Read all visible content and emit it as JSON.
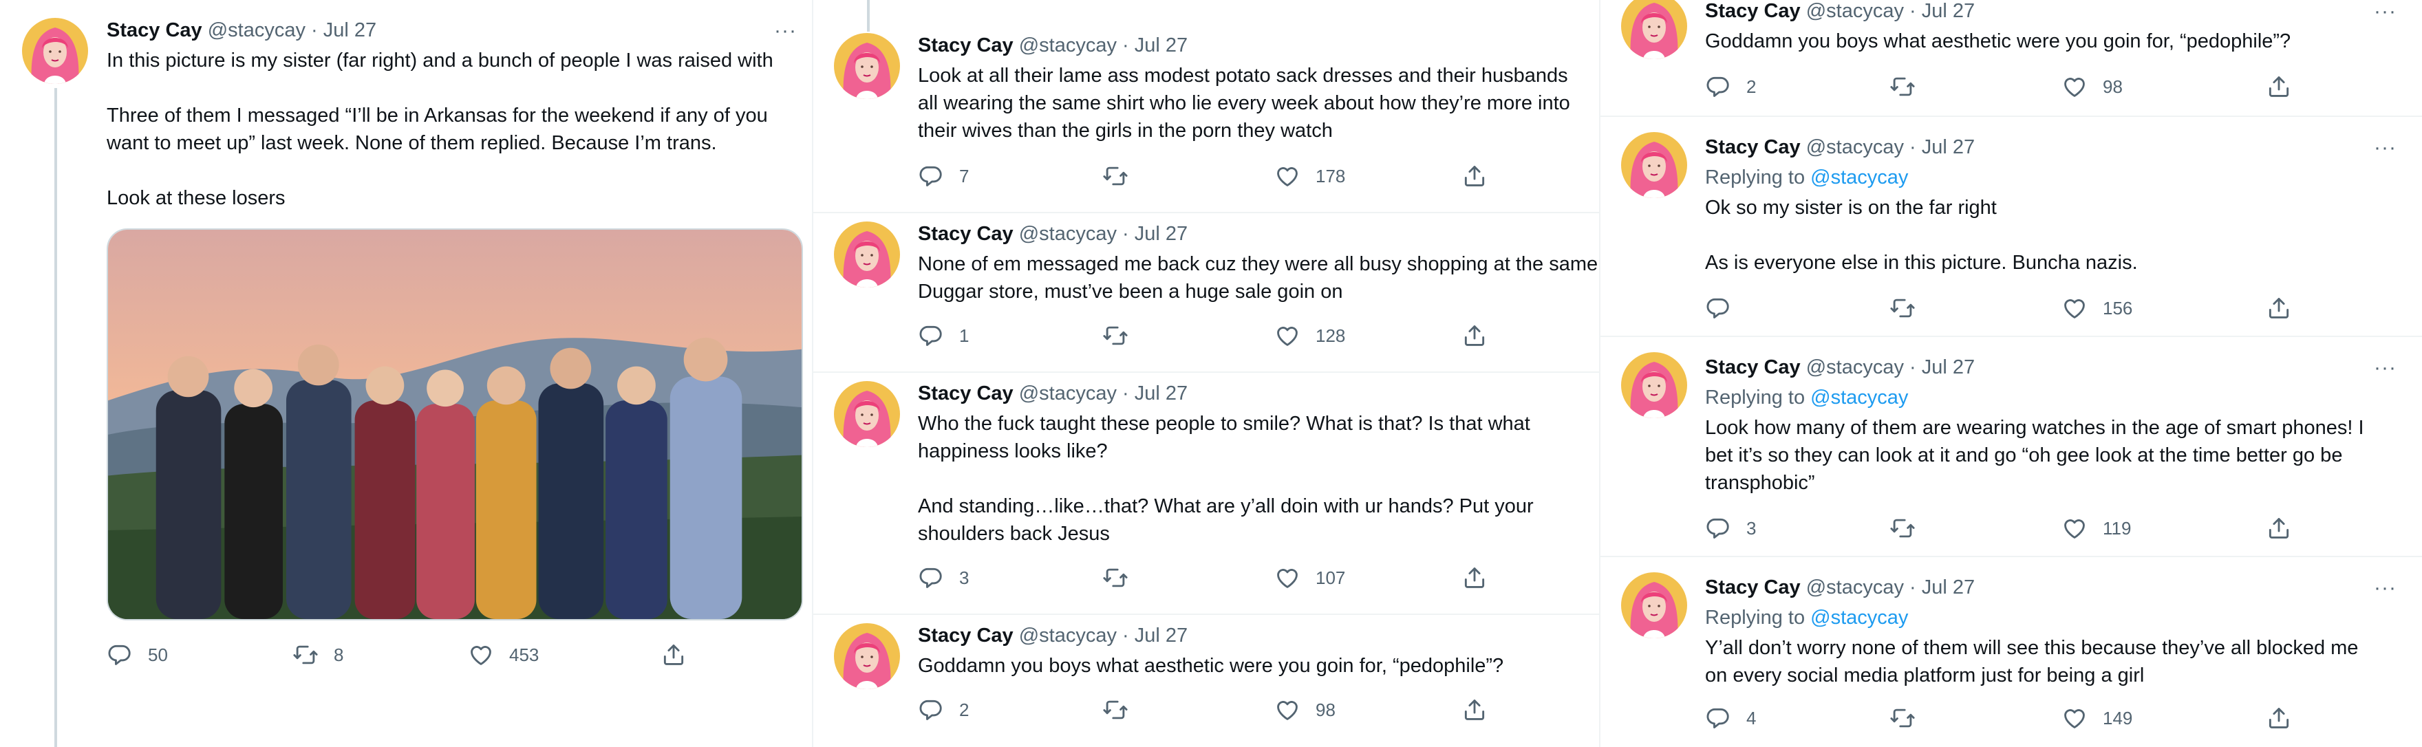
{
  "author": {
    "name": "Stacy Cay",
    "handle": "@stacycay",
    "dot": "·",
    "date": "Jul 27"
  },
  "replying": {
    "prefix": "Replying to ",
    "mention": "@stacycay"
  },
  "more_glyph": "···",
  "icons": {
    "reply": "reply-icon",
    "retweet": "retweet-icon",
    "like": "heart-icon",
    "share": "share-icon"
  },
  "colors": {
    "link": "#1d9bf0",
    "secondary": "#536471",
    "thread_line": "#cfd9de",
    "avatar_bg": "#f2c14e",
    "hair": "#f06292"
  },
  "col1": {
    "t1": {
      "lines": [
        "In this picture is my sister (far right) and a bunch of people I was raised with",
        "Three of them I messaged “I’ll be in Arkansas for the weekend if any of you",
        "want to meet up” last week. None of them replied. Because I’m trans.",
        "Look at these losers"
      ],
      "reply_count": "50",
      "retweet_count": "8",
      "like_count": "453"
    }
  },
  "col2": {
    "t1": {
      "lines": [
        "Look at all their lame ass modest potato sack dresses and their husbands",
        "all wearing the same shirt who lie every week about how they’re more into",
        "their wives than the girls in the porn they watch"
      ],
      "reply_count": "7",
      "like_count": "178"
    },
    "t2": {
      "lines": [
        "None of em messaged me back cuz they were all busy shopping at the same",
        "Duggar store, must’ve been a huge sale goin on"
      ],
      "reply_count": "1",
      "like_count": "128"
    },
    "t3": {
      "lines": [
        "Who the fuck taught these people to smile? What is that? Is that what",
        "happiness looks like?",
        "And standing…like…that? What are y’all doin with ur hands? Put your",
        "shoulders back Jesus"
      ],
      "reply_count": "3",
      "like_count": "107"
    },
    "t4": {
      "lines": [
        "Goddamn you boys what aesthetic were you goin for, “pedophile”?"
      ],
      "reply_count": "2",
      "like_count": "98"
    }
  },
  "col3": {
    "t1": {
      "lines": [
        "Goddamn you boys what aesthetic were you goin for, “pedophile”?"
      ],
      "reply_count": "2",
      "like_count": "98"
    },
    "t2": {
      "lines": [
        "Ok so my sister is on the far right",
        "As is everyone else in this picture. Buncha nazis."
      ],
      "like_count": "156"
    },
    "t3": {
      "lines": [
        "Look how many of them are wearing watches in the age of smart phones! I",
        "bet it’s so they can look at it and go “oh gee look at the time better go be",
        "transphobic”"
      ],
      "reply_count": "3",
      "like_count": "119"
    },
    "t4": {
      "lines": [
        "Y’all don’t worry none of them will see this because they’ve all blocked me",
        "on every social media platform just for being a girl"
      ],
      "reply_count": "4",
      "like_count": "149"
    }
  }
}
